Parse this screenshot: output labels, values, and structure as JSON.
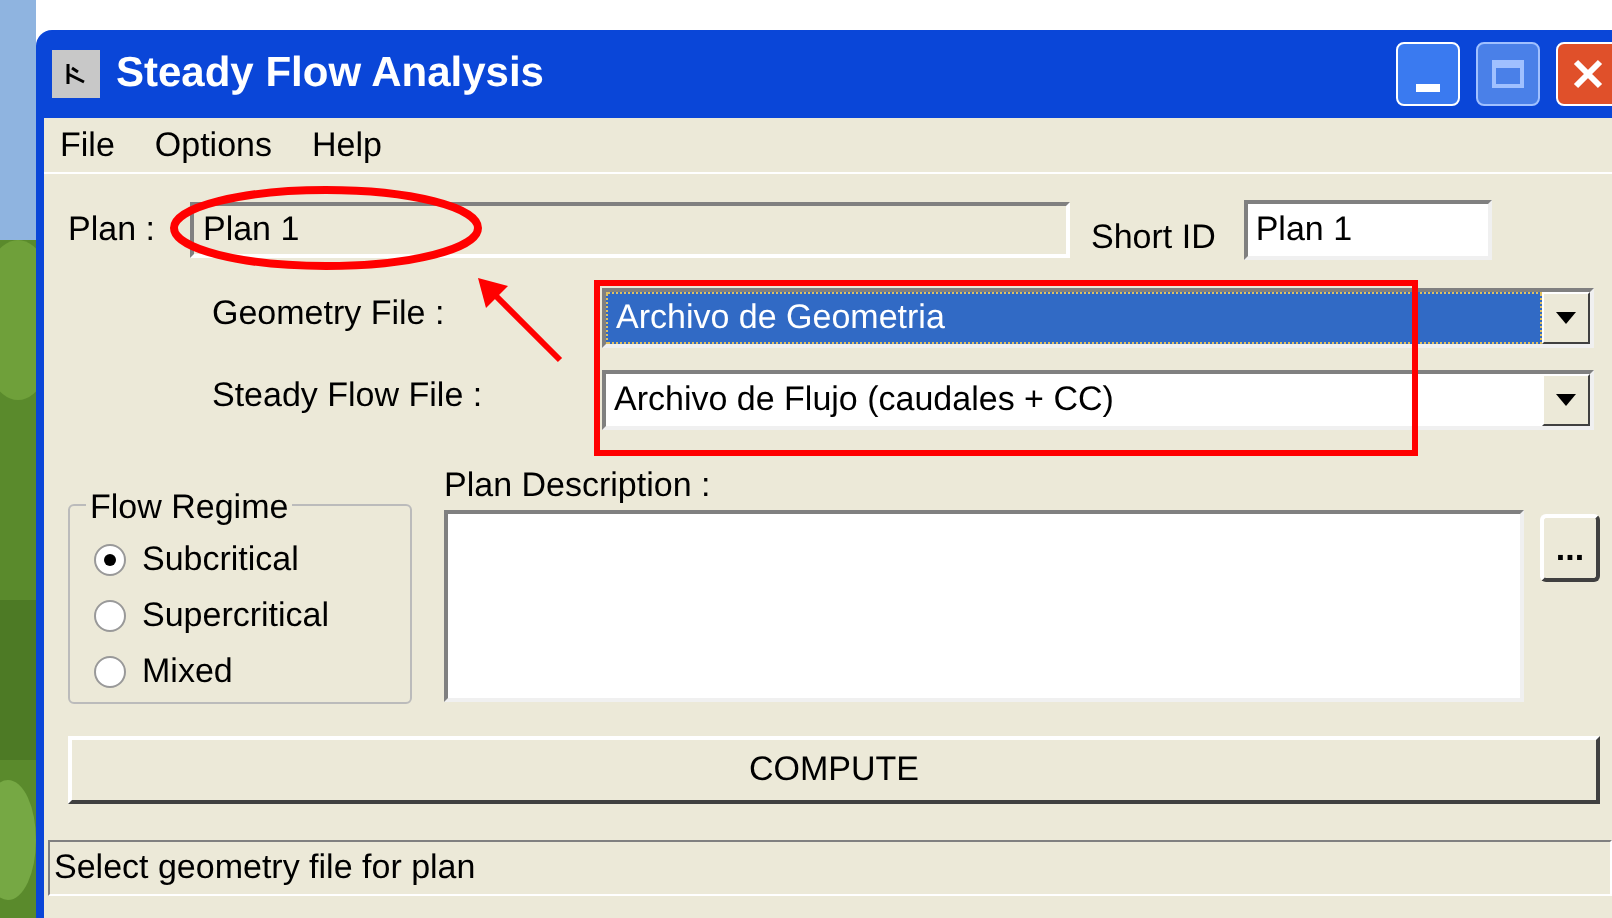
{
  "window": {
    "title": "Steady Flow Analysis"
  },
  "menu": [
    "File",
    "Options",
    "Help"
  ],
  "plan": {
    "label": "Plan :",
    "value": "Plan 1"
  },
  "short_id": {
    "label": "Short ID",
    "value": "Plan 1"
  },
  "geometry_file": {
    "label": "Geometry File :",
    "value": "Archivo de Geometria",
    "focused": true
  },
  "steady_flow_file": {
    "label": "Steady Flow File :",
    "value": "Archivo de Flujo (caudales + CC)",
    "focused": false
  },
  "flow_regime": {
    "title": "Flow Regime",
    "options": [
      {
        "label": "Subcritical",
        "selected": true
      },
      {
        "label": "Supercritical",
        "selected": false
      },
      {
        "label": "Mixed",
        "selected": false
      }
    ]
  },
  "plan_description": {
    "label": "Plan Description :",
    "browse_button": "..."
  },
  "compute_button": "COMPUTE",
  "status_bar": "Select geometry file for plan",
  "annotations": [
    {
      "kind": "ellipse"
    },
    {
      "kind": "rectangle"
    },
    {
      "kind": "arrow"
    }
  ]
}
